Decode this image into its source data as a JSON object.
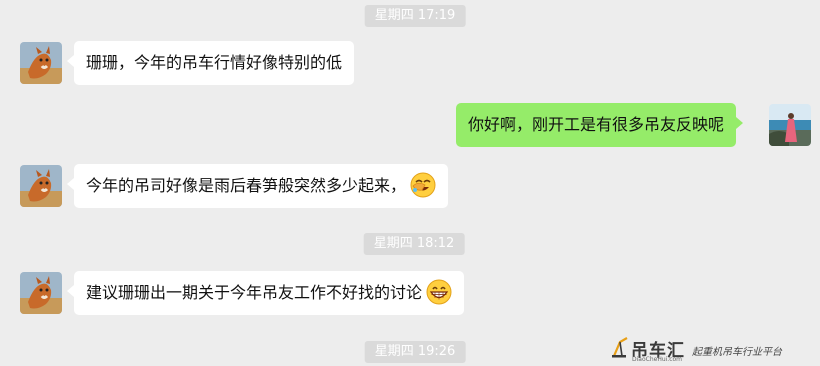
{
  "timestamps": [
    "星期四 17:19",
    "星期四 18:12",
    "星期四 19:26"
  ],
  "messages": [
    {
      "side": "left",
      "text": "珊珊，今年的吊车行情好像特别的低"
    },
    {
      "side": "right",
      "text": "你好啊，刚开工是有很多吊友反映呢"
    },
    {
      "side": "left",
      "text": "今年的吊司好像是雨后春笋般突然多少起来，",
      "emoji": "facepalm-laugh"
    },
    {
      "side": "left",
      "text": "建议珊珊出一期关于今年吊友工作不好找的讨论",
      "emoji": "grin"
    }
  ],
  "watermark": {
    "brand": "吊车汇",
    "url": "DiaoCheHui.com",
    "slogan": "起重机吊车行业平台"
  },
  "colors": {
    "background": "#ededed",
    "incoming_bubble": "#ffffff",
    "outgoing_bubble": "#95ec69",
    "timestamp_bg": "#dadada"
  }
}
